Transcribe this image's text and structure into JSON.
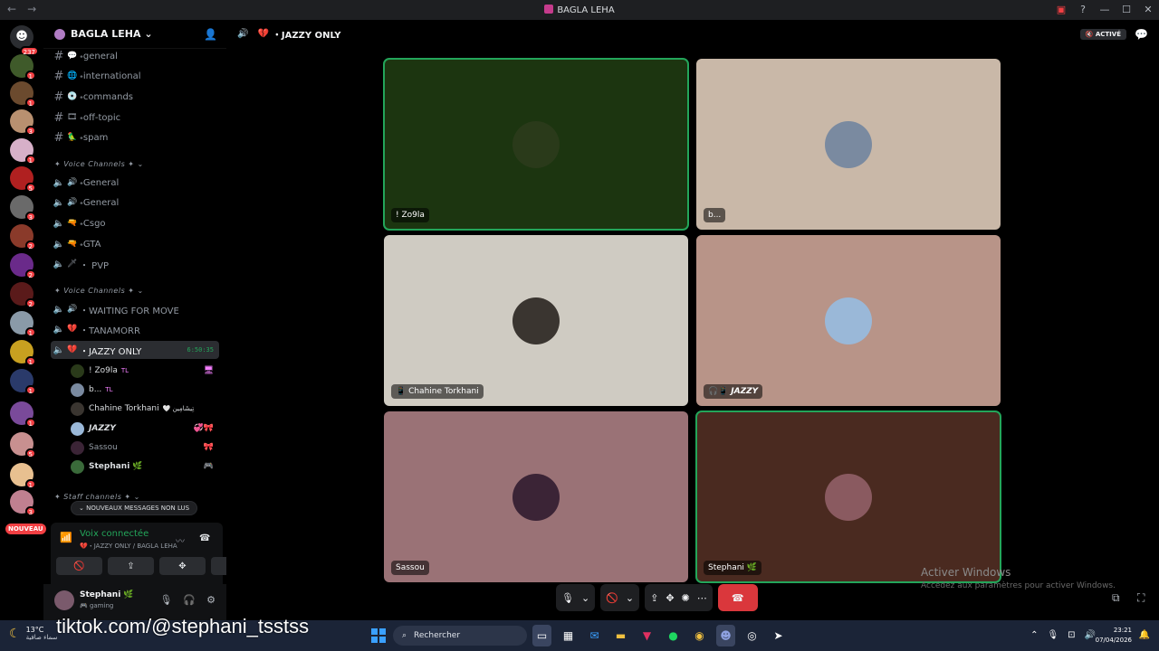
{
  "window": {
    "title": "BAGLA LEHA"
  },
  "rail": {
    "dm_badge": "237",
    "server_badges": [
      "1",
      "1",
      "3",
      "1",
      "5",
      "3",
      "2",
      "2",
      "2",
      "1",
      "1",
      "1",
      "1",
      "5",
      "1",
      "3"
    ]
  },
  "server": {
    "name": "BAGLA LEHA"
  },
  "channels": {
    "text": [
      {
        "emoji": "💬",
        "label": "˖general"
      },
      {
        "emoji": "🌐",
        "label": "˖international"
      },
      {
        "emoji": "💿",
        "label": "˖commands"
      },
      {
        "emoji": "🎞",
        "label": "˖off-topic"
      },
      {
        "emoji": "🦜",
        "label": "˖spam"
      }
    ],
    "voice_category_1": "✦ Voice Channels ✦",
    "voice_1": [
      {
        "emoji": "🔊",
        "label": "˖General"
      },
      {
        "emoji": "🔊",
        "label": "˖General"
      },
      {
        "emoji": "🔫",
        "label": "˖Csgo"
      },
      {
        "emoji": "🔫",
        "label": "˖GTA"
      },
      {
        "emoji": "🗡",
        "label": "・ PVP"
      }
    ],
    "voice_category_2": "✦ Voice Channels ✦",
    "voice_2": [
      {
        "emoji": "🔊",
        "label": "・WAITING FOR MOVE"
      },
      {
        "emoji": "💔",
        "label": "・TANAMORR"
      },
      {
        "emoji": "💔",
        "label": "・JAZZY ONLY",
        "timer": "6:50:35"
      }
    ],
    "staff_category": "✦ Staff channels ✦"
  },
  "voice_users": [
    {
      "name": "! Zo9la",
      "tag": "TL",
      "right": "🖥"
    },
    {
      "name": "b...",
      "tag": "TL",
      "right": ""
    },
    {
      "name": "Chahine Torkhani",
      "tag": "🤍 تِيشَامِين",
      "right": ""
    },
    {
      "name": "𝙅𝘼𝙕𝙕𝙔",
      "tag": "",
      "right": "💞🎀"
    },
    {
      "name": "Sassou",
      "tag": "",
      "right": "🎀"
    },
    {
      "name": "Stephani 🌿",
      "tag": "",
      "right": "🎮"
    }
  ],
  "unread_pill": "⌄ NOUVEAUX MESSAGES NON LUS",
  "nouveau": "NOUVEAU",
  "voice_panel": {
    "status": "Voix connectée",
    "channel": "💔・JAZZY ONLY / BAGLA LEHA"
  },
  "user_panel": {
    "name": "Stephani 🌿",
    "status": "🎮 gaming"
  },
  "main": {
    "channel_title": "・JAZZY ONLY",
    "activity_badge": "🔇 ACTIVÉ",
    "tiles": [
      {
        "name": "! Zo9la",
        "bg": "#1c3510",
        "avatar": "#2a3a1a"
      },
      {
        "name": "b...",
        "bg": "#c9b8a8",
        "avatar": "#7a8aa0"
      },
      {
        "name": "📱 Chahine Torkhani",
        "bg": "#cfcbc2",
        "avatar": "#3a3530"
      },
      {
        "name": "🎧📱 𝙅𝘼𝙕𝙕𝙔",
        "bg": "#b89488",
        "avatar": "#9ab8d8"
      },
      {
        "name": "Sassou",
        "bg": "#9a7276",
        "avatar": "#3b2436"
      },
      {
        "name": "Stephani 🌿",
        "bg": "#4a2a20",
        "avatar": "#8a5a60"
      }
    ]
  },
  "watermark": {
    "line1": "Activer Windows",
    "line2": "Accédez aux paramètres pour activer Windows."
  },
  "tiktok": "tiktok.com/@stephani_tsstss",
  "taskbar": {
    "temp": "13°C",
    "weather": "سماء صافية",
    "search": "Rechercher",
    "time": "23:21",
    "date": "07/04/2026"
  }
}
